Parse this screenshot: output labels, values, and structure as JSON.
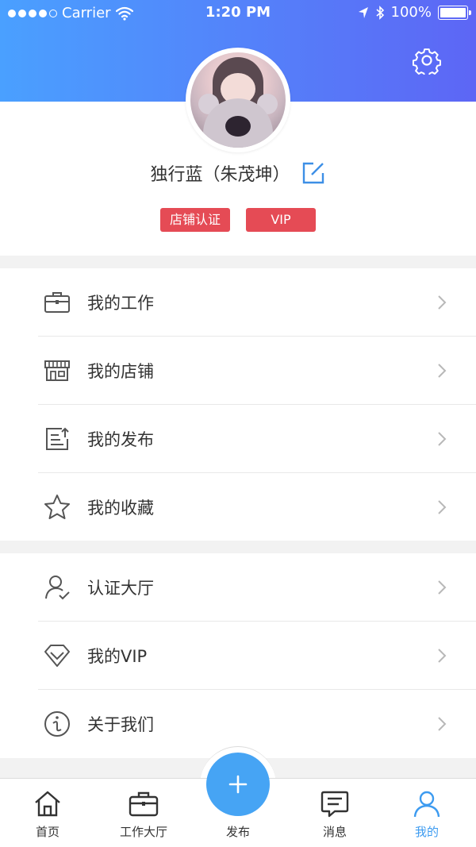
{
  "status_bar": {
    "carrier": "Carrier",
    "time": "1:20 PM",
    "battery": "100%"
  },
  "colors": {
    "header_gradient_start": "#4aa0ff",
    "header_gradient_end": "#5d66f5",
    "badge_red": "#e54b55",
    "accent_blue": "#3d9bf0",
    "fab_blue": "#46a4f4"
  },
  "profile": {
    "name": "独行蓝（朱茂坤）",
    "badges": [
      "店铺认证",
      "VIP"
    ]
  },
  "menu_group_1": [
    {
      "icon": "briefcase-icon",
      "label": "我的工作"
    },
    {
      "icon": "store-icon",
      "label": "我的店铺"
    },
    {
      "icon": "publish-icon",
      "label": "我的发布"
    },
    {
      "icon": "star-icon",
      "label": "我的收藏"
    }
  ],
  "menu_group_2": [
    {
      "icon": "user-verified-icon",
      "label": "认证大厅"
    },
    {
      "icon": "diamond-icon",
      "label": "我的VIP"
    },
    {
      "icon": "info-icon",
      "label": "关于我们"
    }
  ],
  "tab_bar": {
    "items": [
      {
        "icon": "home-icon",
        "label": "首页",
        "active": false
      },
      {
        "icon": "briefcase-icon",
        "label": "工作大厅",
        "active": false
      },
      {
        "icon": "plus-icon",
        "label": "发布",
        "active": false
      },
      {
        "icon": "message-icon",
        "label": "消息",
        "active": false
      },
      {
        "icon": "user-icon",
        "label": "我的",
        "active": true
      }
    ]
  }
}
